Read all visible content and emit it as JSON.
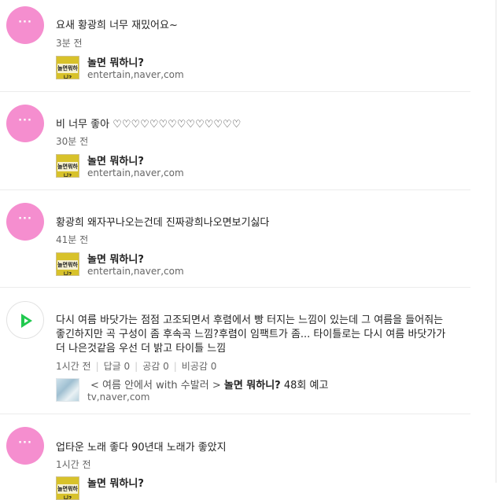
{
  "comments": [
    {
      "text": "요새 황광희 너무 재밌어요~",
      "time": "3분 전",
      "source_title": "놀면 뭐하니?",
      "source_url": "entertain,naver,com",
      "thumb_label": "놀면뭐하니?"
    },
    {
      "text": "비 너무 좋아 ♡♡♡♡♡♡♡♡♡♡♡♡♡♡",
      "time": "30분 전",
      "source_title": "놀면 뭐하니?",
      "source_url": "entertain,naver,com",
      "thumb_label": "놀면뭐하니?"
    },
    {
      "text": "황광희 왜자꾸나오는건데 진짜광희나오면보기싫다",
      "time": "41분 전",
      "source_title": "놀면 뭐하니?",
      "source_url": "entertain,naver,com",
      "thumb_label": "놀면뭐하니?"
    },
    {
      "text_line1": "다시 여름 바닷가는 점점 고조되면서 후렴에서 빵 터지는 느낌이 있는데 그 여름을 들어줘는",
      "text_line2": "좋긴하지만 곡 구성이 좀 후속곡 느낌?후렴이 임팩트가 좀... 타이틀로는 다시 여름 바닷가가",
      "text_line3": "더 나은것같음 우선 더 밝고 타이틀 느낌",
      "time": "1시간 전",
      "replies": "답글 0",
      "likes": "공감 0",
      "dislikes": "비공감 0",
      "source_prefix": "< 여름 안에서 with 수발러 >",
      "source_bold": "놀면 뭐하니?",
      "source_suffix": "48회 예고",
      "source_url": "tv,naver,com"
    },
    {
      "text": "업타운 노래 좋다 90년대 노래가 좋았지",
      "time": "1시간 전",
      "source_title": "놀면 뭐하니?",
      "thumb_label": "놀면뭐하니?"
    }
  ],
  "colors": {
    "avatar_pink": "#f58ecf",
    "play_green": "#21c94f",
    "thumb_yellow": "#d8c22a"
  },
  "icons": {
    "comment_avatar": "speech-bubble-icon",
    "video_avatar": "play-icon"
  }
}
